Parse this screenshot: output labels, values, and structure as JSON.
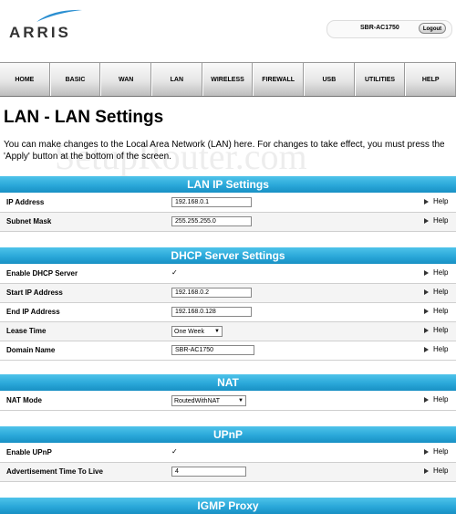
{
  "header": {
    "logo_text": "ARRIS",
    "model": "SBR-AC1750",
    "logout_label": "Logout"
  },
  "nav": {
    "items": [
      {
        "label": "HOME"
      },
      {
        "label": "BASIC"
      },
      {
        "label": "WAN"
      },
      {
        "label": "LAN"
      },
      {
        "label": "WIRELESS"
      },
      {
        "label": "FIREWALL"
      },
      {
        "label": "USB"
      },
      {
        "label": "UTILITIES"
      },
      {
        "label": "HELP"
      }
    ]
  },
  "page": {
    "title": "LAN - LAN Settings",
    "intro": "You can make changes to the Local Area Network (LAN) here. For changes to take effect, you must press the 'Apply' button at the bottom of the screen.",
    "watermark": "SetupRouter.com",
    "help_label": "Help"
  },
  "sections": {
    "lan_ip": {
      "title": "LAN IP Settings",
      "ip_address": {
        "label": "IP Address",
        "value": "192.168.0.1"
      },
      "subnet_mask": {
        "label": "Subnet Mask",
        "value": "255.255.255.0"
      }
    },
    "dhcp": {
      "title": "DHCP Server Settings",
      "enable": {
        "label": "Enable DHCP Server",
        "checked": true
      },
      "start_ip": {
        "label": "Start IP Address",
        "value": "192.168.0.2"
      },
      "end_ip": {
        "label": "End IP Address",
        "value": "192.168.0.128"
      },
      "lease_time": {
        "label": "Lease Time",
        "value": "One Week"
      },
      "domain_name": {
        "label": "Domain Name",
        "value": "SBR-AC1750"
      }
    },
    "nat": {
      "title": "NAT",
      "mode": {
        "label": "NAT Mode",
        "value": "RoutedWithNAT"
      }
    },
    "upnp": {
      "title": "UPnP",
      "enable": {
        "label": "Enable UPnP",
        "checked": true
      },
      "ttl": {
        "label": "Advertisement Time To Live",
        "value": "4"
      }
    },
    "igmp": {
      "title": "IGMP Proxy"
    }
  },
  "icons": {
    "check": "✓",
    "chevron": "▼"
  },
  "colors": {
    "section_header": "#2aa8d9",
    "nav_bg": "#e6e6e6"
  }
}
